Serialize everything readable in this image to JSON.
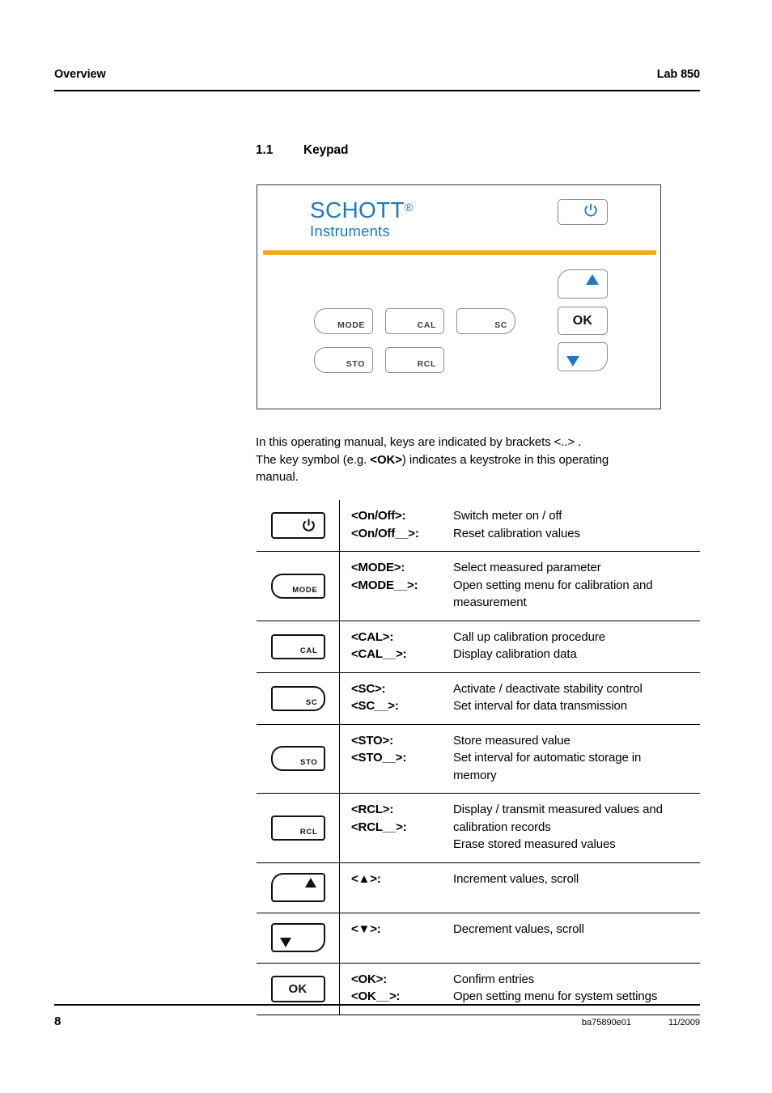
{
  "header": {
    "left": "Overview",
    "right": "Lab 850"
  },
  "section": {
    "number": "1.1",
    "title": "Keypad"
  },
  "keypad_panel": {
    "logo": {
      "main": "SCHOTT",
      "registered": "®",
      "sub": "Instruments"
    },
    "keys": [
      {
        "id": "power",
        "label": "",
        "icon": "power-icon"
      },
      {
        "id": "mode",
        "label": "MODE",
        "icon": ""
      },
      {
        "id": "cal",
        "label": "CAL",
        "icon": ""
      },
      {
        "id": "sc",
        "label": "SC",
        "icon": ""
      },
      {
        "id": "sto",
        "label": "STO",
        "icon": ""
      },
      {
        "id": "rcl",
        "label": "RCL",
        "icon": ""
      },
      {
        "id": "up",
        "label": "",
        "icon": "triangle-up-icon"
      },
      {
        "id": "ok",
        "label": "OK",
        "icon": ""
      },
      {
        "id": "down",
        "label": "",
        "icon": "triangle-down-icon"
      }
    ],
    "colors": {
      "logo_blue": "#1e78c2",
      "accent_orange": "#faa61a",
      "key_border": "#8d8d8d"
    }
  },
  "intro": {
    "line1_a": "In this operating manual, keys are indicated by brackets <..> .",
    "line2_a": "The key symbol (e.g. ",
    "line2_bold": "<OK>",
    "line2_b": ") indicates a keystroke in this operating",
    "line3": "manual."
  },
  "key_table": {
    "rows": [
      {
        "icon": "power-icon",
        "icon_label": "",
        "names": [
          "<On/Off>:",
          "<On/Off__>:"
        ],
        "descriptions": [
          "Switch meter on / off",
          "Reset calibration values"
        ]
      },
      {
        "icon": "mode-key-icon",
        "icon_label": "MODE",
        "names": [
          "<MODE>:",
          "<MODE__>:"
        ],
        "descriptions": [
          "Select measured parameter",
          "Open setting menu for calibration and",
          "measurement"
        ]
      },
      {
        "icon": "cal-key-icon",
        "icon_label": "CAL",
        "names": [
          "<CAL>:",
          "<CAL__>:"
        ],
        "descriptions": [
          "Call up calibration procedure",
          "Display calibration data"
        ]
      },
      {
        "icon": "sc-key-icon",
        "icon_label": "SC",
        "names": [
          "<SC>:",
          "<SC__>:"
        ],
        "descriptions": [
          "Activate / deactivate stability control",
          "Set interval for data transmission"
        ]
      },
      {
        "icon": "sto-key-icon",
        "icon_label": "STO",
        "names": [
          "<STO>:",
          "<STO__>:"
        ],
        "descriptions": [
          "Store measured value",
          "Set interval for automatic storage in",
          "memory"
        ]
      },
      {
        "icon": "rcl-key-icon",
        "icon_label": "RCL",
        "names": [
          "<RCL>:",
          "<RCL__>:"
        ],
        "descriptions": [
          "Display / transmit measured values and",
          "calibration records",
          "Erase stored measured values"
        ]
      },
      {
        "icon": "triangle-up-icon",
        "icon_label": "",
        "names": [
          "<▲>:"
        ],
        "descriptions": [
          "Increment values, scroll"
        ]
      },
      {
        "icon": "triangle-down-icon",
        "icon_label": "",
        "names": [
          "<▼>:"
        ],
        "descriptions": [
          "Decrement values, scroll"
        ]
      },
      {
        "icon": "ok-key-icon",
        "icon_label": "OK",
        "names": [
          "<OK>:",
          "<OK__>:"
        ],
        "descriptions": [
          "Confirm entries",
          "Open setting menu for system settings"
        ]
      }
    ]
  },
  "footer": {
    "page_number": "8",
    "doc_code": "ba75890e01",
    "date": "11/2009"
  }
}
